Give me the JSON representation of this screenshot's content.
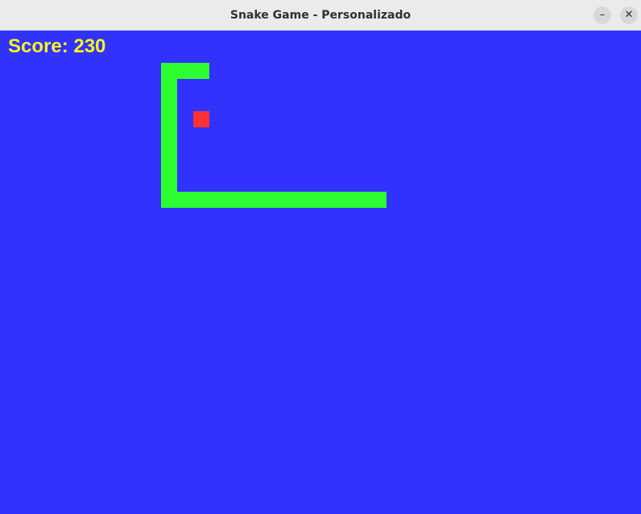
{
  "window": {
    "title": "Snake Game - Personalizado",
    "minimize_icon": "minimize-icon",
    "close_icon": "close-icon"
  },
  "game": {
    "score_text": "Score: 230",
    "score": 230,
    "colors": {
      "background": "#3232fe",
      "snake": "#2cfe30",
      "food": "#fe3232",
      "score_text": "#f4f41e"
    }
  }
}
